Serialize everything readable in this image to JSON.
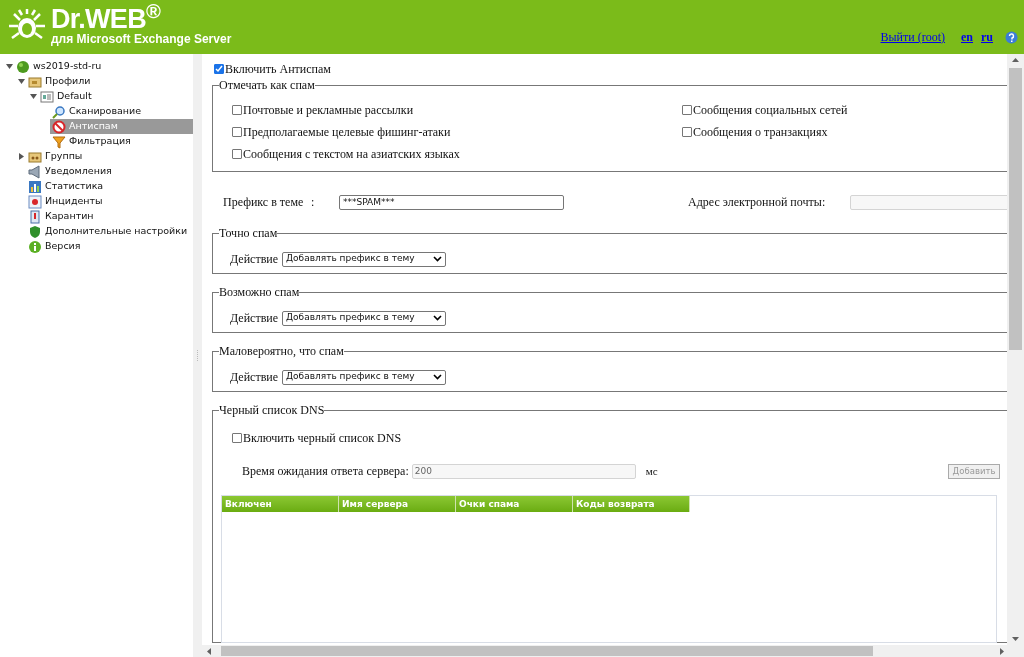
{
  "header": {
    "logo": "Dr.WEB$^{®}$",
    "subtitle": "для Microsoft Exchange Server",
    "links": [
      {
        "kind": "logout",
        "label": "Выйти (root)"
      },
      {
        "kind": "lang",
        "label": "en"
      },
      {
        "kind": "lang",
        "label": "ru"
      }
    ]
  },
  "sidebar": {
    "items": [
      {
        "label": "ws2019-std-ru",
        "kind": "server",
        "expanded": true,
        "selected": false,
        "children": [
          {
            "label": "Профили",
            "kind": "folder",
            "expanded": true,
            "selected": false,
            "children": [
              {
                "label": "Default",
                "kind": "profile",
                "expanded": true,
                "selected": false,
                "children": [
                  {
                    "label": "Сканирование",
                    "kind": "scan",
                    "selected": false
                  },
                  {
                    "label": "Антиспам",
                    "kind": "antispam",
                    "selected": true
                  },
                  {
                    "label": "Фильтрация",
                    "kind": "filter",
                    "selected": false
                  }
                ]
              }
            ]
          },
          {
            "label": "Группы",
            "kind": "groups",
            "expanded": false,
            "selected": false
          },
          {
            "label": "Уведомления",
            "kind": "notifications",
            "selected": false
          },
          {
            "label": "Статистика",
            "kind": "stats",
            "selected": false
          },
          {
            "label": "Инциденты",
            "kind": "incidents",
            "selected": false
          },
          {
            "label": "Карантин",
            "kind": "quarantine",
            "selected": false
          },
          {
            "label": "Дополнительные настройки",
            "kind": "settings",
            "selected": false
          },
          {
            "label": "Версия",
            "kind": "version",
            "selected": false
          }
        ]
      }
    ]
  },
  "enable": {
    "label": "Включить Антиспам",
    "checked": true
  },
  "mark_as_spam": {
    "title": "Отмечать как спам",
    "columns": [
      [
        {
          "label": "Почтовые и рекламные рассылки",
          "checked": false
        },
        {
          "label": "Предполагаемые целевые фишинг-атаки",
          "checked": false
        },
        {
          "label": "Сообщения с текстом на азиатских языках",
          "checked": false
        }
      ],
      [
        {
          "label": "Сообщения социальных сетей",
          "checked": false
        },
        {
          "label": "Сообщения о транзакциях",
          "checked": false
        }
      ]
    ]
  },
  "prefix": {
    "label": "Префикс в теме",
    "colon": ":",
    "value": "***SPAM***"
  },
  "email": {
    "label": "Адрес электронной почты",
    "colon": ":",
    "disabled": true
  },
  "sections": [
    {
      "title": "Точно спам",
      "action_label": "Действие",
      "action": "Добавлять префикс в тему"
    },
    {
      "title": "Возможно спам",
      "action_label": "Действие",
      "action": "Добавлять префикс в тему"
    },
    {
      "title": "Маловероятно, что спам",
      "action_label": "Действие",
      "action": "Добавлять префикс в тему"
    }
  ],
  "dns": {
    "title": "Черный список DNS",
    "enable": {
      "label": "Включить черный список DNS",
      "checked": false
    },
    "timeout_label": "Время ожидания ответа сервера:",
    "timeout": "200",
    "unit": "мс",
    "timeout_disabled": true,
    "add_button": {
      "label": "Добавить",
      "disabled": true
    },
    "table": {
      "columns": [
        "Включен",
        "Имя сервера",
        "Очки спама",
        "Коды возврата"
      ]
    }
  }
}
